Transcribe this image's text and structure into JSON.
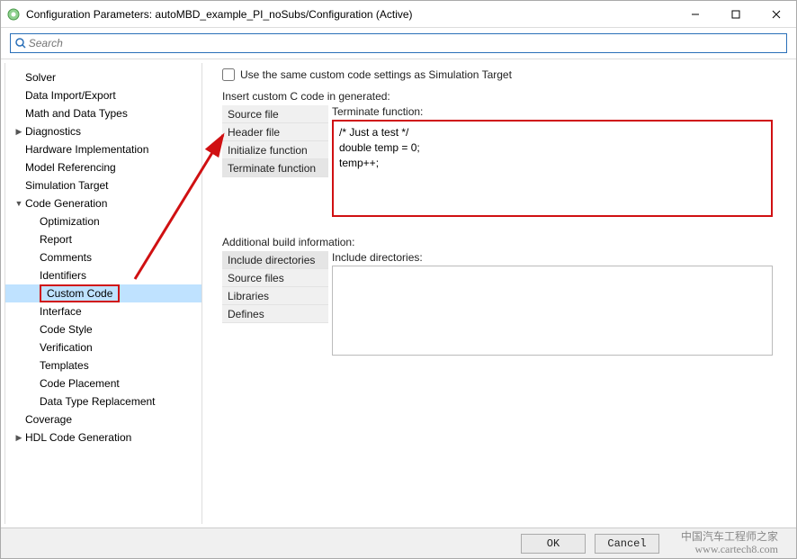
{
  "window": {
    "title": "Configuration Parameters: autoMBD_example_PI_noSubs/Configuration (Active)"
  },
  "search": {
    "placeholder": "Search"
  },
  "tree": {
    "items": [
      {
        "label": "Solver",
        "level": 1,
        "expandable": false
      },
      {
        "label": "Data Import/Export",
        "level": 1,
        "expandable": false
      },
      {
        "label": "Math and Data Types",
        "level": 1,
        "expandable": false
      },
      {
        "label": "Diagnostics",
        "level": 1,
        "expandable": true,
        "collapsed": true
      },
      {
        "label": "Hardware Implementation",
        "level": 1,
        "expandable": false
      },
      {
        "label": "Model Referencing",
        "level": 1,
        "expandable": false
      },
      {
        "label": "Simulation Target",
        "level": 1,
        "expandable": false
      },
      {
        "label": "Code Generation",
        "level": 1,
        "expandable": true,
        "collapsed": false
      },
      {
        "label": "Optimization",
        "level": 2,
        "expandable": false
      },
      {
        "label": "Report",
        "level": 2,
        "expandable": false
      },
      {
        "label": "Comments",
        "level": 2,
        "expandable": false
      },
      {
        "label": "Identifiers",
        "level": 2,
        "expandable": false
      },
      {
        "label": "Custom Code",
        "level": 2,
        "expandable": false,
        "selected": true
      },
      {
        "label": "Interface",
        "level": 2,
        "expandable": false
      },
      {
        "label": "Code Style",
        "level": 2,
        "expandable": false
      },
      {
        "label": "Verification",
        "level": 2,
        "expandable": false
      },
      {
        "label": "Templates",
        "level": 2,
        "expandable": false
      },
      {
        "label": "Code Placement",
        "level": 2,
        "expandable": false
      },
      {
        "label": "Data Type Replacement",
        "level": 2,
        "expandable": false
      },
      {
        "label": "Coverage",
        "level": 1,
        "expandable": false
      },
      {
        "label": "HDL Code Generation",
        "level": 1,
        "expandable": true,
        "collapsed": true
      }
    ]
  },
  "right": {
    "same_settings_label": "Use the same custom code settings as Simulation Target",
    "insert_heading": "Insert custom C code in generated:",
    "code_tabs": [
      "Source file",
      "Header file",
      "Initialize function",
      "Terminate function"
    ],
    "code_active_tab": "Terminate function",
    "code_field_label": "Terminate function:",
    "code_value": "/* Just a test */\ndouble temp = 0;\ntemp++;",
    "build_heading": "Additional build information:",
    "build_tabs": [
      "Include directories",
      "Source files",
      "Libraries",
      "Defines"
    ],
    "build_active_tab": "Include directories",
    "build_field_label": "Include directories:",
    "build_value": ""
  },
  "buttons": {
    "ok": "OK",
    "cancel": "Cancel"
  },
  "watermark": {
    "line1": "中国汽车工程师之家",
    "line2": "www.cartech8.com"
  }
}
